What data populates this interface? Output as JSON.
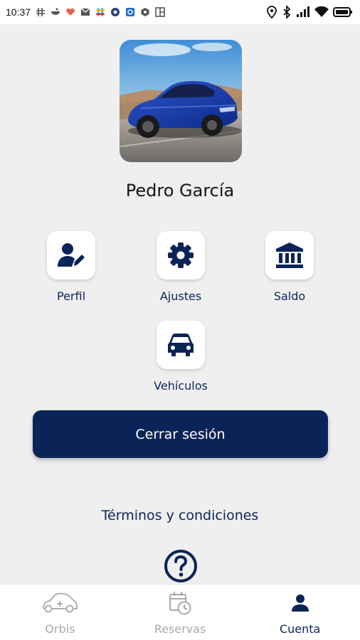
{
  "status_bar": {
    "time": "10:37",
    "notification_icons": [
      "hashtag-icon",
      "bowl-icon",
      "heart-pulse-icon",
      "gmail-icon",
      "slack-icon",
      "app-circle-icon",
      "app-square-icon",
      "hex-app-icon",
      "board-icon"
    ],
    "system_icons": [
      "location-icon",
      "bluetooth-icon",
      "signal-icon",
      "wifi-icon",
      "battery-icon"
    ]
  },
  "profile": {
    "name": "Pedro García"
  },
  "menu": {
    "items": [
      {
        "label": "Perfil",
        "icon": "user-edit-icon"
      },
      {
        "label": "Ajustes",
        "icon": "gear-icon"
      },
      {
        "label": "Saldo",
        "icon": "bank-icon"
      },
      {
        "label": "Vehículos",
        "icon": "car-icon"
      }
    ]
  },
  "actions": {
    "logout_label": "Cerrar sesión",
    "terms_label": "Términos y condiciones",
    "help_icon": "question-circle-icon"
  },
  "bottom_nav": {
    "items": [
      {
        "label": "Orbis",
        "icon": "car-outline-icon",
        "active": false
      },
      {
        "label": "Reservas",
        "icon": "calendar-clock-icon",
        "active": false
      },
      {
        "label": "Cuenta",
        "icon": "person-icon",
        "active": true
      }
    ]
  },
  "colors": {
    "primary": "#0b2458",
    "background": "#efefef",
    "inactive": "#a8a8a8",
    "surface": "#ffffff"
  }
}
